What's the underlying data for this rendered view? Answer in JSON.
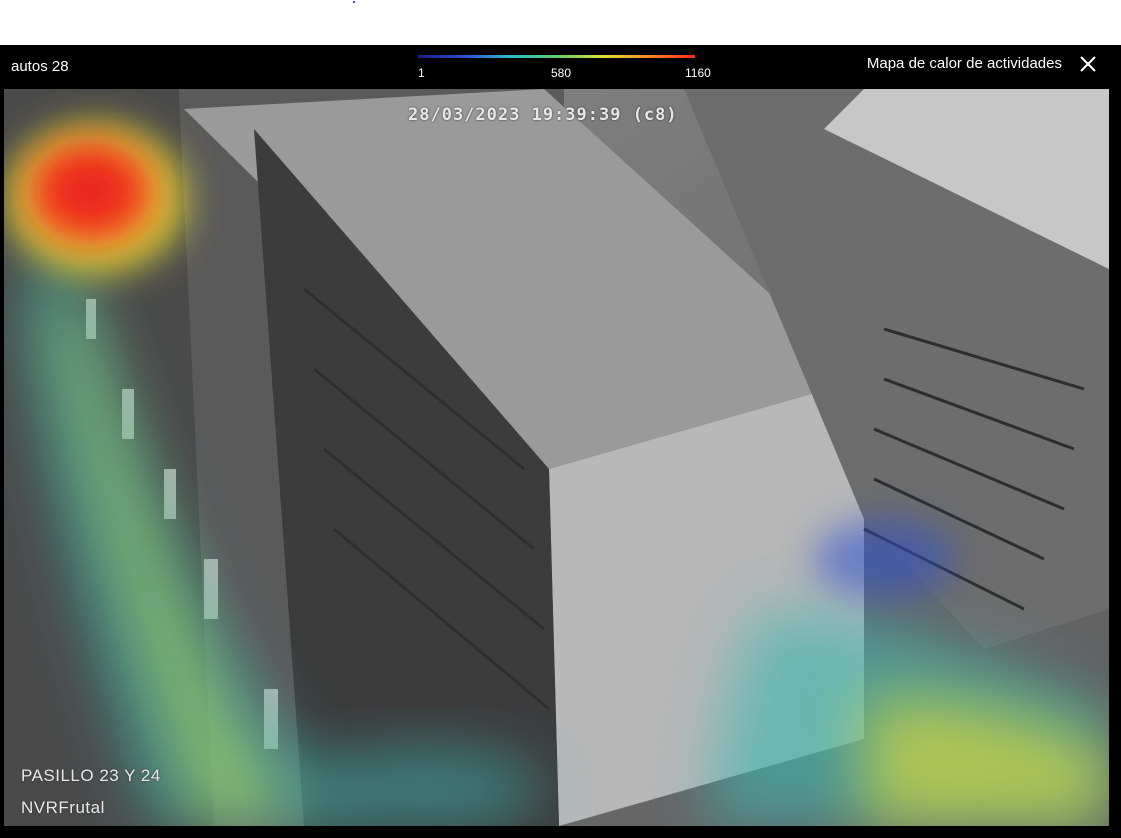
{
  "header": {
    "camera_name": "autos 28",
    "title": "Mapa de calor de actividades",
    "close_icon": "close-icon"
  },
  "scale": {
    "min_label": "1",
    "mid_label": "580",
    "max_label": "1160",
    "colors": [
      "#1b1b8a",
      "#2d4fd6",
      "#2eb8c9",
      "#5fcf6a",
      "#d9df3b",
      "#ff8a2a",
      "#ff2a1a"
    ]
  },
  "video": {
    "timestamp": "28/03/2023 19:39:39 (c8)",
    "aisle_label": "PASILLO 23 Y 24",
    "recorder_label": "NVRFrutal"
  },
  "colors": {
    "dialog_background": "#000000",
    "text": "#ffffff"
  }
}
